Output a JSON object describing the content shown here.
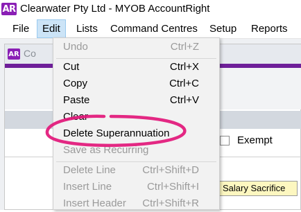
{
  "window": {
    "logo": "AR",
    "title": "Clearwater Pty Ltd - MYOB AccountRight"
  },
  "menubar": {
    "items": [
      "File",
      "Edit",
      "Lists",
      "Command Centres",
      "Setup",
      "Reports"
    ],
    "active": "Edit"
  },
  "background_window": {
    "logo": "AR",
    "title": "Co",
    "exempt_label": "Exempt",
    "salary_cell": "Salary Sacrifice"
  },
  "edit_menu": {
    "items": [
      {
        "label": "Undo",
        "shortcut": "Ctrl+Z",
        "enabled": false
      },
      {
        "label": "Cut",
        "shortcut": "Ctrl+X",
        "enabled": true
      },
      {
        "label": "Copy",
        "shortcut": "Ctrl+C",
        "enabled": true
      },
      {
        "label": "Paste",
        "shortcut": "Ctrl+V",
        "enabled": true
      },
      {
        "label": "Clear",
        "shortcut": "",
        "enabled": true
      },
      {
        "label": "Delete Superannuation",
        "shortcut": "",
        "enabled": true
      },
      {
        "label": "Save as Recurring",
        "shortcut": "",
        "enabled": false
      },
      {
        "label": "Delete Line",
        "shortcut": "Ctrl+Shift+D",
        "enabled": false
      },
      {
        "label": "Insert Line",
        "shortcut": "Ctrl+Shift+I",
        "enabled": false
      },
      {
        "label": "Insert Header",
        "shortcut": "Ctrl+Shift+R",
        "enabled": false
      }
    ],
    "highlighted_item": "Delete Superannuation"
  },
  "colors": {
    "brand_purple": "#8a1fb5",
    "highlight_ring": "#e2177a",
    "menu_active": "#cce4f7"
  }
}
